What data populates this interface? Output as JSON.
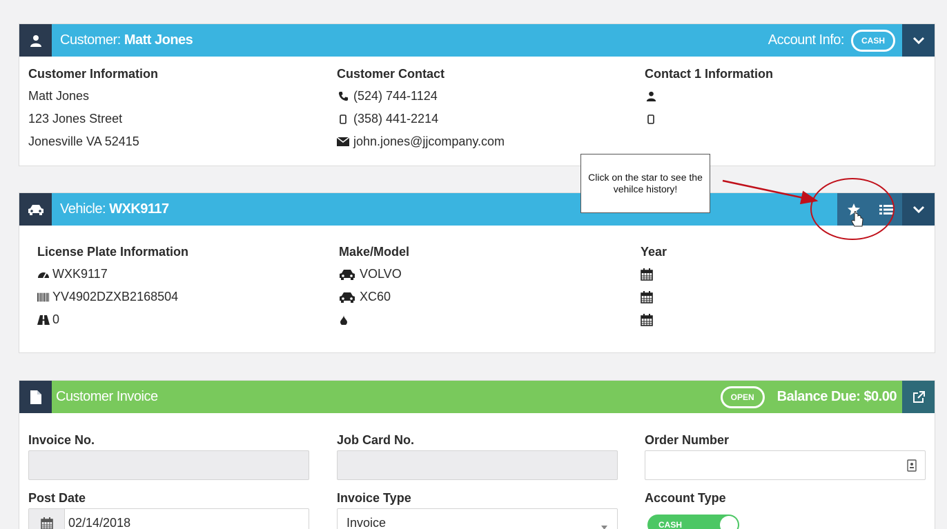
{
  "customer": {
    "title_prefix": "Customer:",
    "name": "Matt Jones",
    "account_info_label": "Account Info:",
    "account_badge": "CASH",
    "info": {
      "heading": "Customer Information",
      "lines": [
        "Matt Jones",
        "123 Jones Street",
        "Jonesville VA 52415"
      ]
    },
    "contact": {
      "heading": "Customer Contact",
      "phone": "(524) 744-1124",
      "mobile": "(358) 441-2214",
      "email": "john.jones@jjcompany.com"
    },
    "contact1": {
      "heading": "Contact 1 Information"
    }
  },
  "vehicle": {
    "title_prefix": "Vehicle:",
    "plate": "WXK9117",
    "license": {
      "heading": "License Plate Information",
      "plate": "WXK9117",
      "vin": "YV4902DZXB2168504",
      "mileage": "0"
    },
    "make_model": {
      "heading": "Make/Model",
      "make": "VOLVO",
      "model": "XC60"
    },
    "year": {
      "heading": "Year"
    }
  },
  "invoice": {
    "title": "Customer Invoice",
    "status_badge": "OPEN",
    "balance_due": "Balance Due: $0.00",
    "fields": {
      "invoice_no": "Invoice No.",
      "job_card_no": "Job Card No.",
      "order_number": "Order Number",
      "post_date": "Post Date",
      "post_date_value": "02/14/2018",
      "invoice_type": "Invoice Type",
      "invoice_type_value": "Invoice",
      "account_type": "Account Type",
      "account_type_toggle": "CASH"
    }
  },
  "annotation": {
    "callout_text": "Click on the star to see the vehilce history!"
  },
  "colors": {
    "header_blue": "#3ab4e0",
    "header_green": "#79c95c",
    "icon_block": "#2a3a4f",
    "annotation_red": "#c0101a"
  }
}
